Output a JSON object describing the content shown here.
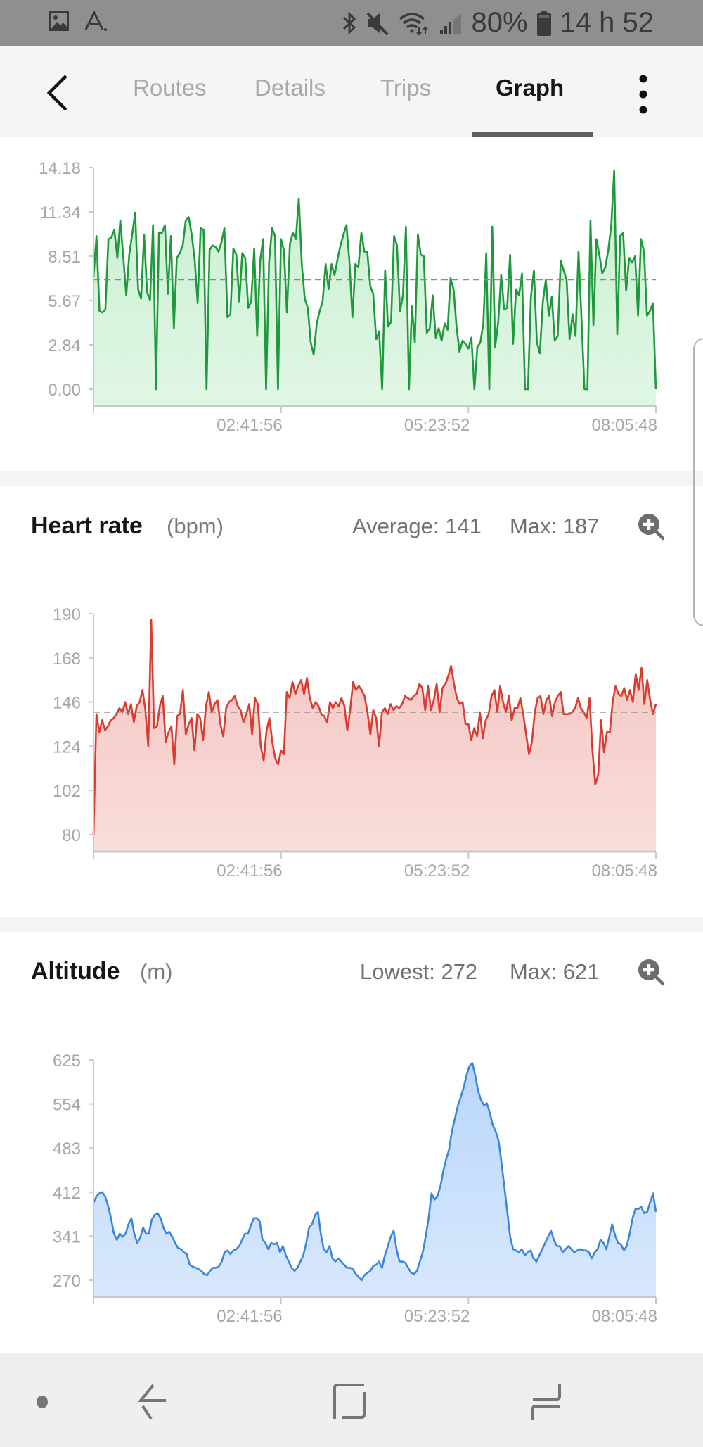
{
  "status_bar": {
    "left_icons": [
      "gallery-icon",
      "app-a-icon"
    ],
    "right_icons": [
      "bluetooth-icon",
      "mute-icon",
      "wifi-icon",
      "signal-icon",
      "battery-icon"
    ],
    "battery": "80%",
    "time": "14 h 52"
  },
  "app_bar": {
    "back_icon": "chevron-left-icon",
    "tabs": [
      {
        "label": "Routes",
        "active": false
      },
      {
        "label": "Details",
        "active": false
      },
      {
        "label": "Trips",
        "active": false
      },
      {
        "label": "Graph",
        "active": true
      }
    ],
    "more_icon": "more-vertical-icon"
  },
  "colors": {
    "speed_line": "#1e9a3c",
    "speed_fill": "#c8efd0",
    "hr_line": "#d93c30",
    "hr_fill": "#f4c3bf",
    "alt_line": "#3b86dc",
    "alt_fill": "#b9d6fb",
    "tab_underline": "#5f6064"
  },
  "cards": {
    "heart_rate": {
      "title": "Heart rate",
      "unit": "(bpm)",
      "stat1": "Average: 141",
      "stat2": "Max: 187",
      "zoom_icon": "zoom-in-icon"
    },
    "altitude": {
      "title": "Altitude",
      "unit": "(m)",
      "stat1": "Lowest: 272",
      "stat2": "Max: 621",
      "zoom_icon": "zoom-in-icon"
    }
  },
  "chart_data": [
    {
      "type": "area",
      "name": "speed",
      "title": "",
      "xlabel": "",
      "ylabel": "",
      "yticks": [
        "0.00",
        "2.84",
        "5.67",
        "8.51",
        "11.34",
        "14.18"
      ],
      "ylim": [
        0,
        14.18
      ],
      "xticks": [
        "",
        "02:41:56",
        "05:23:52",
        "08:05:48"
      ],
      "average": 7.0,
      "grid": false,
      "values": [
        7.2,
        9.8,
        5.0,
        4.9,
        5.1,
        9.6,
        9.7,
        10.2,
        8.4,
        10.8,
        8.5,
        6.0,
        8.6,
        9.9,
        11.3,
        6.4,
        5.8,
        9.9,
        6.2,
        5.7,
        10.5,
        0.0,
        10.0,
        10.0,
        10.5,
        6.1,
        9.8,
        3.9,
        8.4,
        8.7,
        9.2,
        10.8,
        11.0,
        9.9,
        8.3,
        5.5,
        10.3,
        10.2,
        0.0,
        8.9,
        9.2,
        9.1,
        8.8,
        9.4,
        10.3,
        4.6,
        4.8,
        9.0,
        8.6,
        5.6,
        8.7,
        8.4,
        5.2,
        5.6,
        9.0,
        3.4,
        8.2,
        9.6,
        0.0,
        8.1,
        10.3,
        9.8,
        0.0,
        9.6,
        8.9,
        4.9,
        9.3,
        10.0,
        9.6,
        12.2,
        8.0,
        5.8,
        5.2,
        3.0,
        2.2,
        4.2,
        5.0,
        5.6,
        8.0,
        6.4,
        8.0,
        7.3,
        8.3,
        9.2,
        9.9,
        10.5,
        8.2,
        4.6,
        8.0,
        7.8,
        10.0,
        8.8,
        8.8,
        6.6,
        6.1,
        3.2,
        3.7,
        0.0,
        7.6,
        4.0,
        4.3,
        9.8,
        9.2,
        5.0,
        6.0,
        10.4,
        0.0,
        5.3,
        3.0,
        9.9,
        8.6,
        8.5,
        3.6,
        3.9,
        6.0,
        3.3,
        3.9,
        3.1,
        4.2,
        3.8,
        7.1,
        6.4,
        4.0,
        2.4,
        3.1,
        2.9,
        2.6,
        3.3,
        0.0,
        2.7,
        3.0,
        4.2,
        8.7,
        0.0,
        10.4,
        2.7,
        4.3,
        7.3,
        5.1,
        5.2,
        8.6,
        2.9,
        6.4,
        6.0,
        7.4,
        0.0,
        0.0,
        5.9,
        7.6,
        3.0,
        2.3,
        5.6,
        7.0,
        4.7,
        5.9,
        3.1,
        3.4,
        8.2,
        7.6,
        7.0,
        3.2,
        4.8,
        3.4,
        8.8,
        4.5,
        0.0,
        0.0,
        10.8,
        4.1,
        9.6,
        8.6,
        7.4,
        7.8,
        8.9,
        10.5,
        14.0,
        3.5,
        9.8,
        10.0,
        6.3,
        8.4,
        8.1,
        8.5,
        4.7,
        9.6,
        8.8,
        4.7,
        5.0,
        5.5,
        0.0
      ]
    },
    {
      "type": "area",
      "name": "heart_rate",
      "title": "Heart rate",
      "xlabel": "",
      "ylabel": "bpm",
      "yticks": [
        "80",
        "102",
        "124",
        "146",
        "168",
        "190"
      ],
      "ylim": [
        80,
        190
      ],
      "xticks": [
        "",
        "02:41:56",
        "05:23:52",
        "08:05:48"
      ],
      "average": 141,
      "max": 187,
      "grid": false,
      "values": [
        80,
        140,
        131,
        137,
        132,
        134,
        137,
        138,
        140,
        143,
        141,
        146,
        140,
        145,
        136,
        144,
        146,
        152,
        142,
        124,
        187,
        133,
        134,
        144,
        149,
        126,
        131,
        134,
        115,
        139,
        140,
        152,
        130,
        135,
        138,
        122,
        140,
        138,
        127,
        144,
        151,
        141,
        145,
        147,
        135,
        129,
        143,
        146,
        147,
        149,
        144,
        142,
        136,
        140,
        145,
        130,
        148,
        145,
        124,
        117,
        132,
        138,
        126,
        118,
        115,
        122,
        120,
        151,
        148,
        156,
        150,
        154,
        157,
        150,
        158,
        148,
        143,
        146,
        144,
        140,
        139,
        136,
        146,
        143,
        146,
        144,
        148,
        144,
        132,
        142,
        156,
        152,
        154,
        152,
        149,
        141,
        130,
        142,
        138,
        124,
        141,
        143,
        140,
        145,
        142,
        144,
        143,
        145,
        149,
        148,
        147,
        149,
        150,
        155,
        153,
        142,
        154,
        142,
        147,
        155,
        141,
        153,
        155,
        159,
        164,
        155,
        148,
        145,
        146,
        135,
        135,
        127,
        133,
        129,
        141,
        128,
        137,
        140,
        149,
        152,
        141,
        154,
        146,
        141,
        149,
        137,
        143,
        143,
        148,
        140,
        130,
        120,
        126,
        141,
        148,
        149,
        140,
        147,
        149,
        139,
        146,
        149,
        151,
        140,
        140,
        140,
        141,
        143,
        148,
        143,
        141,
        138,
        148,
        122,
        105,
        110,
        137,
        121,
        131,
        131,
        146,
        154,
        150,
        149,
        153,
        147,
        152,
        146,
        160,
        152,
        163,
        145,
        157,
        147,
        140,
        145
      ]
    },
    {
      "type": "area",
      "name": "altitude",
      "title": "Altitude",
      "xlabel": "",
      "ylabel": "m",
      "yticks": [
        "270",
        "341",
        "412",
        "483",
        "554",
        "625"
      ],
      "ylim": [
        270,
        625
      ],
      "xticks": [
        "",
        "02:41:56",
        "05:23:52",
        "08:05:48"
      ],
      "min": 272,
      "max": 621,
      "grid": false,
      "values": [
        395,
        405,
        410,
        412,
        405,
        390,
        370,
        345,
        335,
        345,
        340,
        345,
        360,
        370,
        345,
        330,
        338,
        355,
        345,
        345,
        368,
        375,
        378,
        370,
        355,
        345,
        348,
        340,
        330,
        322,
        320,
        315,
        312,
        295,
        292,
        290,
        288,
        285,
        280,
        278,
        285,
        290,
        290,
        292,
        300,
        315,
        318,
        312,
        318,
        320,
        325,
        335,
        345,
        345,
        358,
        370,
        370,
        365,
        335,
        330,
        320,
        330,
        328,
        330,
        315,
        325,
        310,
        300,
        290,
        285,
        290,
        300,
        310,
        330,
        355,
        360,
        375,
        380,
        345,
        320,
        315,
        325,
        305,
        300,
        305,
        300,
        295,
        290,
        290,
        288,
        280,
        275,
        270,
        278,
        282,
        285,
        293,
        295,
        300,
        290,
        310,
        325,
        340,
        350,
        320,
        300,
        300,
        298,
        290,
        282,
        280,
        285,
        300,
        315,
        340,
        370,
        410,
        400,
        405,
        420,
        445,
        465,
        480,
        510,
        530,
        550,
        565,
        580,
        600,
        615,
        620,
        600,
        575,
        560,
        552,
        555,
        540,
        520,
        510,
        495,
        460,
        420,
        380,
        340,
        320,
        318,
        315,
        320,
        310,
        315,
        318,
        305,
        300,
        310,
        320,
        330,
        340,
        350,
        335,
        325,
        325,
        315,
        320,
        325,
        320,
        315,
        318,
        320,
        318,
        318,
        315,
        305,
        315,
        320,
        335,
        330,
        320,
        340,
        360,
        342,
        330,
        328,
        318,
        325,
        345,
        370,
        385,
        385,
        388,
        378,
        380,
        395,
        410,
        380
      ]
    }
  ],
  "nav_bar": {
    "icons": [
      "dot-icon",
      "back-nav-icon",
      "home-icon",
      "recents-icon"
    ]
  }
}
